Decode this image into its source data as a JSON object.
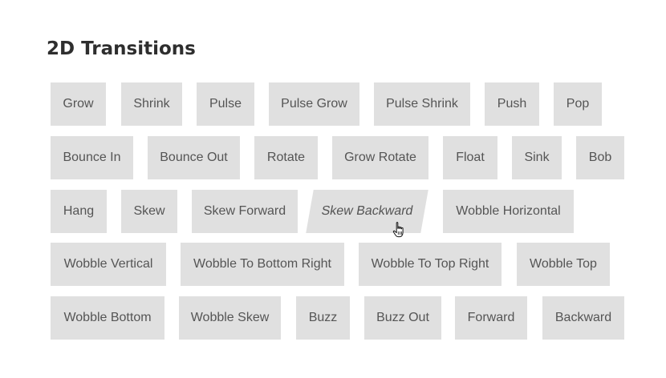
{
  "page": {
    "title": "2D Transitions"
  },
  "buttons": [
    "Grow",
    "Shrink",
    "Pulse",
    "Pulse Grow",
    "Pulse Shrink",
    "Push",
    "Pop",
    "Bounce In",
    "Bounce Out",
    "Rotate",
    "Grow Rotate",
    "Float",
    "Sink",
    "Bob",
    "Hang",
    "Skew",
    "Skew Forward",
    "Skew Backward",
    "Wobble Horizontal",
    "Wobble Vertical",
    "Wobble To Bottom Right",
    "Wobble To Top Right",
    "Wobble Top",
    "Wobble Bottom",
    "Wobble Skew",
    "Buzz",
    "Buzz Out",
    "Forward",
    "Backward"
  ],
  "hovered_button": "Skew Backward",
  "colors": {
    "button_bg": "#e0e0e0",
    "button_text": "#555555",
    "title_text": "#2e2e2e"
  },
  "icons": {
    "cursor": "hand-pointer-icon"
  }
}
